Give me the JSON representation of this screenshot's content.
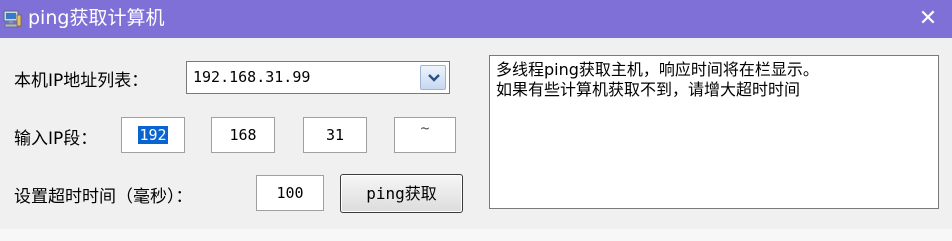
{
  "window": {
    "title": "ping获取计算机",
    "close_glyph": "✕",
    "titlebar_color": "#7f70d8"
  },
  "form": {
    "ip_list_label": "本机IP地址列表：",
    "ip_list_selected": "192.168.31.99",
    "ip_segment_label": "输入IP段：",
    "ip_segment": [
      "192",
      "168",
      "31",
      "~"
    ],
    "timeout_label": "设置超时时间（毫秒）：",
    "timeout_value": "100",
    "ping_button_label": "ping获取"
  },
  "output": {
    "lines": [
      "多线程ping获取主机，响应时间将在栏显示。",
      "如果有些计算机获取不到，请增大超时时间"
    ]
  },
  "icons": {
    "app": "computer-icon",
    "dropdown": "chevron-down-icon",
    "close": "close-icon"
  },
  "colors": {
    "selection": "#0a64d0"
  }
}
